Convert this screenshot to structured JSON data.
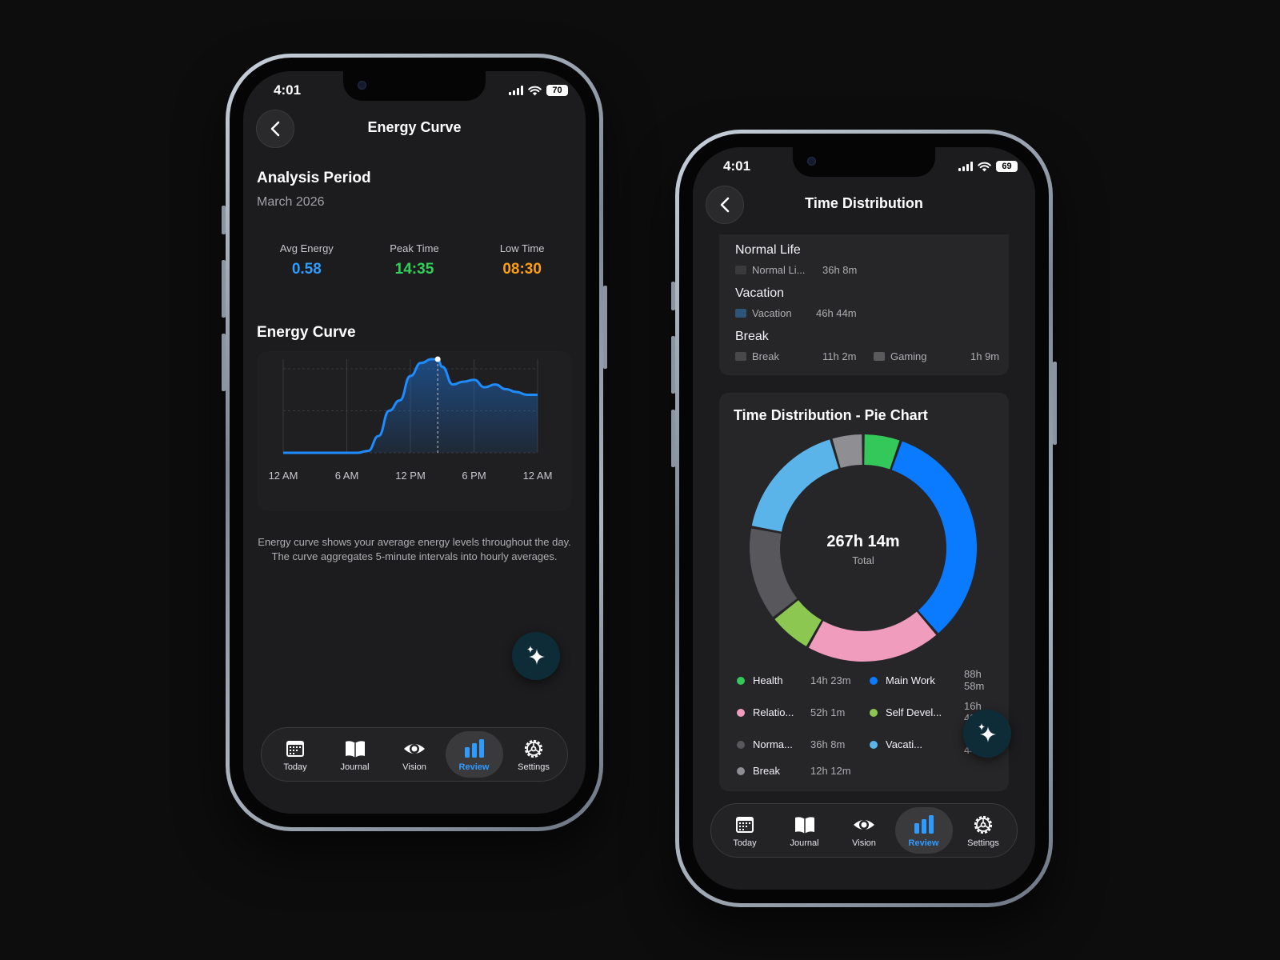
{
  "phone1": {
    "status": {
      "time": "4:01",
      "battery": "70"
    },
    "nav_title": "Energy Curve",
    "period_title": "Analysis Period",
    "period_value": "March 2026",
    "stats": [
      {
        "label": "Avg Energy",
        "value": "0.58",
        "color": "#2f9bff"
      },
      {
        "label": "Peak Time",
        "value": "14:35",
        "color": "#30d158"
      },
      {
        "label": "Low Time",
        "value": "08:30",
        "color": "#ff9f0a"
      }
    ],
    "chart_title": "Energy Curve",
    "note": "Energy curve shows your average energy levels throughout the day. The curve aggregates 5-minute intervals into hourly averages.",
    "chart_data": {
      "type": "area",
      "x_ticks": [
        "12 AM",
        "6 AM",
        "12 PM",
        "6 PM",
        "12 AM"
      ],
      "x": [
        0,
        1,
        2,
        3,
        4,
        5,
        6,
        7,
        8,
        9,
        10,
        11,
        12,
        13,
        14,
        14.58,
        15,
        16,
        17,
        18,
        19,
        20,
        21,
        22,
        23,
        24
      ],
      "values": [
        0,
        0,
        0,
        0,
        0,
        0,
        0,
        0,
        0.02,
        0.18,
        0.45,
        0.56,
        0.82,
        0.96,
        1.0,
        1.0,
        0.92,
        0.73,
        0.76,
        0.78,
        0.7,
        0.73,
        0.68,
        0.65,
        0.62,
        0.62
      ],
      "highlight_x": 14.58,
      "xlim": [
        0,
        24
      ],
      "ylim": [
        0,
        1
      ],
      "line_color": "#1e8bff",
      "grid": true
    }
  },
  "phone2": {
    "status": {
      "time": "4:01",
      "battery": "69"
    },
    "nav_title": "Time Distribution",
    "categories": [
      {
        "name": "Normal Life",
        "items": [
          {
            "label": "Normal Li...",
            "value": "36h 8m",
            "color": "#3a3a3c"
          }
        ]
      },
      {
        "name": "Vacation",
        "items": [
          {
            "label": "Vacation",
            "value": "46h 44m",
            "color": "#2e5577"
          }
        ]
      },
      {
        "name": "Break",
        "items": [
          {
            "label": "Break",
            "value": "11h 2m",
            "color": "#48484a"
          },
          {
            "label": "Gaming",
            "value": "1h 9m",
            "color": "#5a5a5d"
          }
        ]
      }
    ],
    "pie_title": "Time Distribution - Pie Chart",
    "pie_center_value": "267h 14m",
    "pie_center_label": "Total",
    "chart_data": {
      "type": "pie",
      "labels": [
        "Health",
        "Main Work",
        "Relationships",
        "Self Development",
        "Normal Life",
        "Vacation",
        "Break"
      ],
      "values": [
        14.38,
        88.97,
        52.02,
        16.7,
        36.13,
        46.73,
        12.2
      ],
      "colors": [
        "#34c759",
        "#0a7aff",
        "#f09dbd",
        "#8cc751",
        "#58585c",
        "#5ab4ea",
        "#8e8e93"
      ]
    },
    "legend": [
      {
        "label": "Health",
        "value": "14h 23m",
        "color": "#34c759"
      },
      {
        "label": "Main Work",
        "value": "88h 58m",
        "color": "#0a7aff"
      },
      {
        "label": "Relatio...",
        "value": "52h 1m",
        "color": "#f09dbd"
      },
      {
        "label": "Self Devel...",
        "value": "16h 42m",
        "color": "#8cc751"
      },
      {
        "label": "Norma...",
        "value": "36h 8m",
        "color": "#58585c"
      },
      {
        "label": "Vacati...",
        "value": "46h 44m",
        "color": "#5ab4ea"
      },
      {
        "label": "Break",
        "value": "12h 12m",
        "color": "#8e8e93"
      }
    ]
  },
  "tabs": [
    {
      "label": "Today",
      "icon": "calendar-icon"
    },
    {
      "label": "Journal",
      "icon": "book-icon"
    },
    {
      "label": "Vision",
      "icon": "eye-icon"
    },
    {
      "label": "Review",
      "icon": "bar-chart-icon",
      "active": true
    },
    {
      "label": "Settings",
      "icon": "gear-icon"
    }
  ]
}
